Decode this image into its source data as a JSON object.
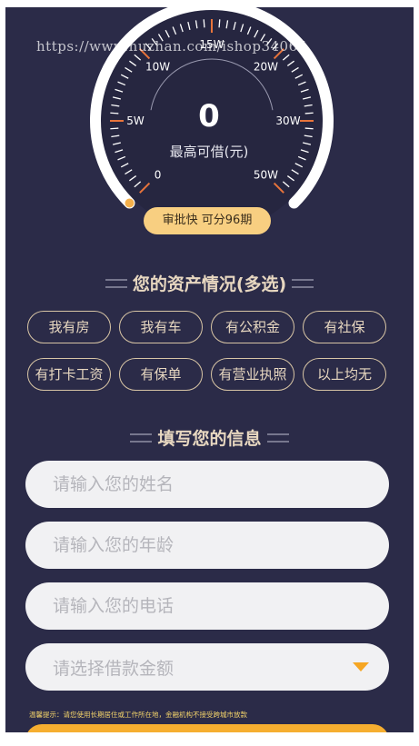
{
  "watermark": "https://www.huzhan.com/ishop34065",
  "gauge": {
    "value": "0",
    "caption": "最高可借(元)",
    "scale_labels": [
      "0",
      "5W",
      "10W",
      "15W",
      "20W",
      "30W",
      "50W"
    ],
    "level_fraction": 0,
    "badge": "审批快 可分96期",
    "colors": {
      "arc": "#ffffff",
      "ticks": "#ffffff",
      "major_ticks": "#e8743b",
      "start_marker": "#f4b04b"
    }
  },
  "assets": {
    "title": "您的资产情况(多选)",
    "options": [
      "我有房",
      "我有车",
      "有公积金",
      "有社保",
      "有打卡工资",
      "有保单",
      "有营业执照",
      "以上均无"
    ]
  },
  "info": {
    "title": "填写您的信息",
    "name_placeholder": "请输入您的姓名",
    "age_placeholder": "请输入您的年龄",
    "phone_placeholder": "请输入您的电话",
    "amount_placeholder": "请选择借款金额",
    "tip": "温馨提示：请您使用长期居住或工作所在地，金融机构不接受跨城市放款"
  },
  "colors": {
    "background": "#2b2b48",
    "accent": "#f6ae30",
    "chip_border": "#d8c5a5",
    "badge": "#f8cf81"
  }
}
